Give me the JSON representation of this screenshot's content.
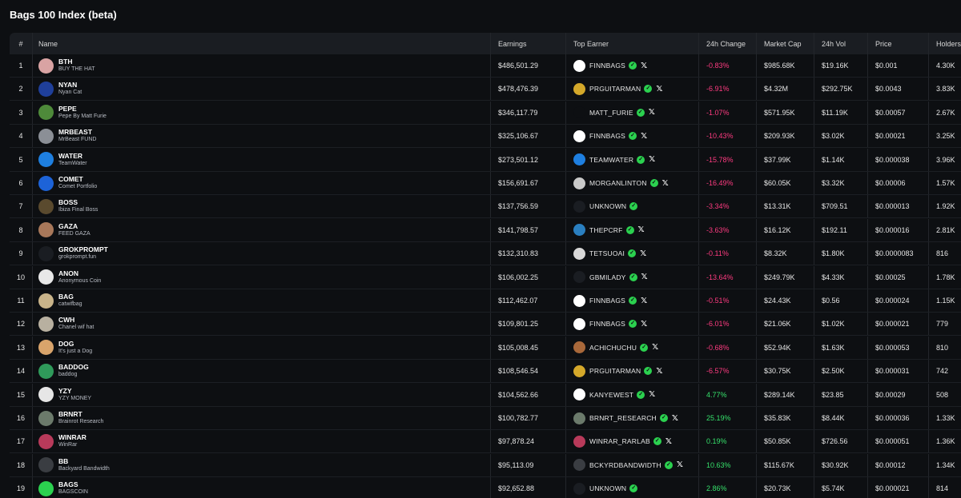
{
  "page": {
    "title": "Bags 100 Index (beta)"
  },
  "columns": {
    "idx": "#",
    "name": "Name",
    "earnings": "Earnings",
    "top_earner": "Top Earner",
    "change": "24h Change",
    "market_cap": "Market Cap",
    "volume": "24h Vol",
    "price": "Price",
    "holders": "Holders"
  },
  "colors": {
    "negative": "#ff3b81",
    "positive": "#36e06b",
    "verified": "#2bd14f",
    "header_bg": "#1a1d22",
    "page_bg": "#0d0f12"
  },
  "rows": [
    {
      "idx": "1",
      "symbol": "BTH",
      "name": "BUY THE HAT",
      "earnings": "$486,501.29",
      "earner": "FINNBAGS",
      "x": true,
      "change": "-0.83%",
      "trend": "neg",
      "mcap": "$985.68K",
      "vol": "$19.16K",
      "price": "$0.001",
      "holders": "4.30K",
      "avatar_color": "#d9a3a3",
      "earner_icon": "#ffffff"
    },
    {
      "idx": "2",
      "symbol": "NYAN",
      "name": "Nyan Cat",
      "earnings": "$478,476.39",
      "earner": "PRGUITARMAN",
      "x": true,
      "change": "-6.91%",
      "trend": "neg",
      "mcap": "$4.32M",
      "vol": "$292.75K",
      "price": "$0.0043",
      "holders": "3.83K",
      "avatar_color": "#1f3f9a",
      "earner_icon": "#d4a82a"
    },
    {
      "idx": "3",
      "symbol": "PEPE",
      "name": "Pepe By Matt Furie",
      "earnings": "$346,117.79",
      "earner": "MATT_FURIE",
      "x": true,
      "change": "-1.07%",
      "trend": "neg",
      "mcap": "$571.95K",
      "vol": "$11.19K",
      "price": "$0.00057",
      "holders": "2.67K",
      "avatar_color": "#4e8a3a",
      "earner_icon": "#0d0f12"
    },
    {
      "idx": "4",
      "symbol": "MRBEAST",
      "name": "MrBeast FUND",
      "earnings": "$325,106.67",
      "earner": "FINNBAGS",
      "x": true,
      "change": "-10.43%",
      "trend": "neg",
      "mcap": "$209.93K",
      "vol": "$3.02K",
      "price": "$0.00021",
      "holders": "3.25K",
      "avatar_color": "#8b8f96",
      "earner_icon": "#ffffff"
    },
    {
      "idx": "5",
      "symbol": "WATER",
      "name": "TeamWater",
      "earnings": "$273,501.12",
      "earner": "TEAMWATER",
      "x": true,
      "change": "-15.78%",
      "trend": "neg",
      "mcap": "$37.99K",
      "vol": "$1.14K",
      "price": "$0.000038",
      "holders": "3.96K",
      "avatar_color": "#1e7fe0",
      "earner_icon": "#1e7fe0"
    },
    {
      "idx": "6",
      "symbol": "COMET",
      "name": "Comet Portfolio",
      "earnings": "$156,691.67",
      "earner": "MORGANLINTON",
      "x": true,
      "change": "-16.49%",
      "trend": "neg",
      "mcap": "$60.05K",
      "vol": "$3.32K",
      "price": "$0.00006",
      "holders": "1.57K",
      "avatar_color": "#1d63d8",
      "earner_icon": "#c9c9c9"
    },
    {
      "idx": "7",
      "symbol": "BOSS",
      "name": "Ibiza Final Boss",
      "earnings": "$137,756.59",
      "earner": "UNKNOWN",
      "x": false,
      "change": "-3.34%",
      "trend": "neg",
      "mcap": "$13.31K",
      "vol": "$709.51",
      "price": "$0.000013",
      "holders": "1.92K",
      "avatar_color": "#5a4a2e",
      "earner_icon": "#1a1d22"
    },
    {
      "idx": "8",
      "symbol": "GAZA",
      "name": "FEED GAZA",
      "earnings": "$141,798.57",
      "earner": "THEPCRF",
      "x": true,
      "change": "-3.63%",
      "trend": "neg",
      "mcap": "$16.12K",
      "vol": "$192.11",
      "price": "$0.000016",
      "holders": "2.81K",
      "avatar_color": "#a8785a",
      "earner_icon": "#2a7fc0"
    },
    {
      "idx": "9",
      "symbol": "GROKPROMPT",
      "name": "grokprompt.fun",
      "earnings": "$132,310.83",
      "earner": "TETSUOAI",
      "x": true,
      "change": "-0.11%",
      "trend": "neg",
      "mcap": "$8.32K",
      "vol": "$1.80K",
      "price": "$0.0000083",
      "holders": "816",
      "avatar_color": "#1a1d22",
      "earner_icon": "#d8d8d8"
    },
    {
      "idx": "10",
      "symbol": "ANON",
      "name": "Anonymous Coin",
      "earnings": "$106,002.25",
      "earner": "GBMILADY",
      "x": true,
      "change": "-13.64%",
      "trend": "neg",
      "mcap": "$249.79K",
      "vol": "$4.33K",
      "price": "$0.00025",
      "holders": "1.78K",
      "avatar_color": "#e8e8e8",
      "earner_icon": "#1a1d22"
    },
    {
      "idx": "11",
      "symbol": "BAG",
      "name": "catwifbag",
      "earnings": "$112,462.07",
      "earner": "FINNBAGS",
      "x": true,
      "change": "-0.51%",
      "trend": "neg",
      "mcap": "$24.43K",
      "vol": "$0.56",
      "price": "$0.000024",
      "holders": "1.15K",
      "avatar_color": "#c9b48a",
      "earner_icon": "#ffffff"
    },
    {
      "idx": "12",
      "symbol": "CWH",
      "name": "Chanel wif hat",
      "earnings": "$109,801.25",
      "earner": "FINNBAGS",
      "x": true,
      "change": "-6.01%",
      "trend": "neg",
      "mcap": "$21.06K",
      "vol": "$1.02K",
      "price": "$0.000021",
      "holders": "779",
      "avatar_color": "#b8b0a0",
      "earner_icon": "#ffffff"
    },
    {
      "idx": "13",
      "symbol": "DOG",
      "name": "It's just a Dog",
      "earnings": "$105,008.45",
      "earner": "ACHICHUCHU",
      "x": true,
      "change": "-0.68%",
      "trend": "neg",
      "mcap": "$52.94K",
      "vol": "$1.63K",
      "price": "$0.000053",
      "holders": "810",
      "avatar_color": "#d9a46b",
      "earner_icon": "#a8683a"
    },
    {
      "idx": "14",
      "symbol": "BADDOG",
      "name": "baddog",
      "earnings": "$108,546.54",
      "earner": "PRGUITARMAN",
      "x": true,
      "change": "-6.57%",
      "trend": "neg",
      "mcap": "$30.75K",
      "vol": "$2.50K",
      "price": "$0.000031",
      "holders": "742",
      "avatar_color": "#2f9a5a",
      "earner_icon": "#d4a82a"
    },
    {
      "idx": "15",
      "symbol": "YZY",
      "name": "YZY MONEY",
      "earnings": "$104,562.66",
      "earner": "KANYEWEST",
      "x": true,
      "change": "4.77%",
      "trend": "pos",
      "mcap": "$289.14K",
      "vol": "$23.85",
      "price": "$0.00029",
      "holders": "508",
      "avatar_color": "#e6e6e6",
      "earner_icon": "#ffffff"
    },
    {
      "idx": "16",
      "symbol": "BRNRT",
      "name": "Brainrot Research",
      "earnings": "$100,782.77",
      "earner": "BRNRT_RESEARCH",
      "x": true,
      "change": "25.19%",
      "trend": "pos",
      "mcap": "$35.83K",
      "vol": "$8.44K",
      "price": "$0.000036",
      "holders": "1.33K",
      "avatar_color": "#6b7a6b",
      "earner_icon": "#6b7a6b"
    },
    {
      "idx": "17",
      "symbol": "WINRAR",
      "name": "WinRar",
      "earnings": "$97,878.24",
      "earner": "WINRAR_RARLAB",
      "x": true,
      "change": "0.19%",
      "trend": "pos",
      "mcap": "$50.85K",
      "vol": "$726.56",
      "price": "$0.000051",
      "holders": "1.36K",
      "avatar_color": "#b83a5a",
      "earner_icon": "#b83a5a"
    },
    {
      "idx": "18",
      "symbol": "BB",
      "name": "Backyard Bandwidth",
      "earnings": "$95,113.09",
      "earner": "BCKYRDBANDWIDTH",
      "x": true,
      "change": "10.63%",
      "trend": "pos",
      "mcap": "$115.67K",
      "vol": "$30.92K",
      "price": "$0.00012",
      "holders": "1.34K",
      "avatar_color": "#3a3d42",
      "earner_icon": "#3a3d42"
    },
    {
      "idx": "19",
      "symbol": "BAGS",
      "name": "BAGSCOIN",
      "earnings": "$92,652.88",
      "earner": "UNKNOWN",
      "x": false,
      "change": "2.86%",
      "trend": "pos",
      "mcap": "$20.73K",
      "vol": "$5.74K",
      "price": "$0.000021",
      "holders": "814",
      "avatar_color": "#2bd14f",
      "earner_icon": "#1a1d22"
    }
  ]
}
